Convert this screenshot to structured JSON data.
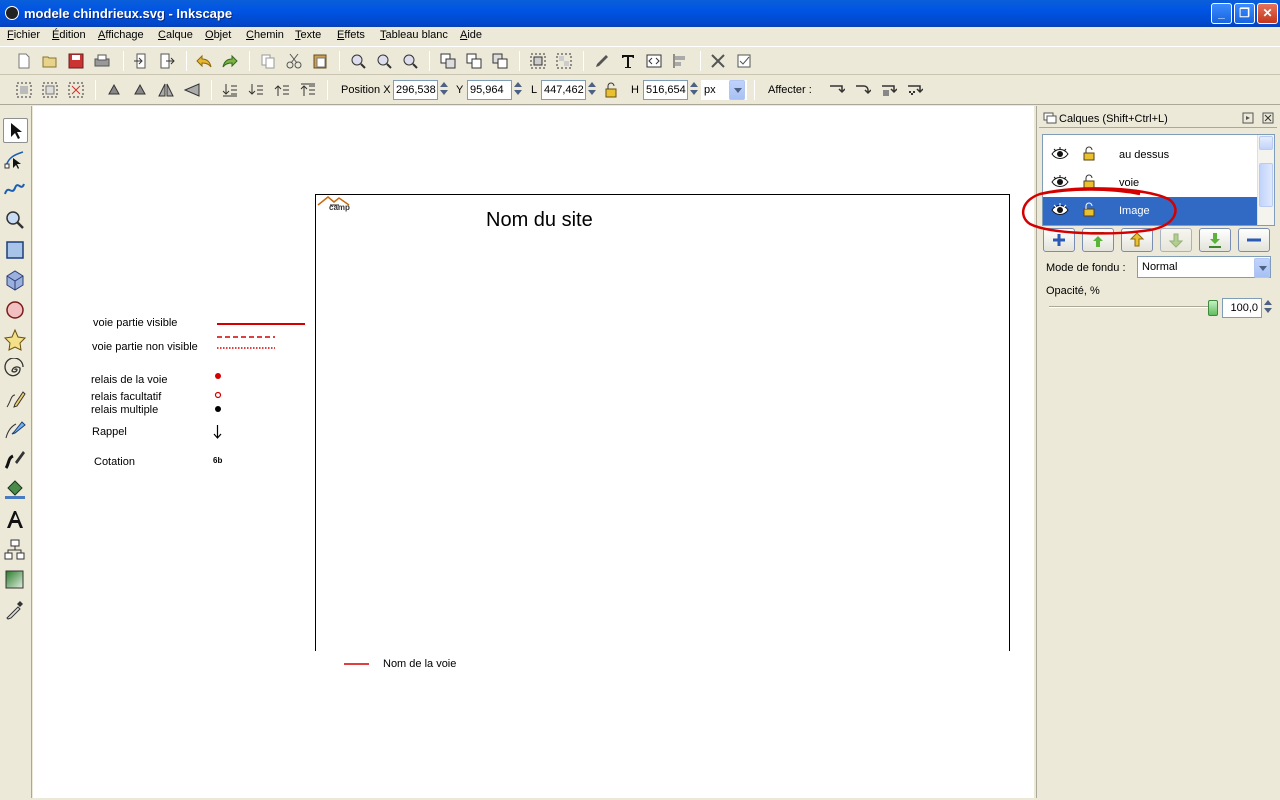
{
  "window": {
    "title": "modele chindrieux.svg - Inkscape",
    "minimize_glyph": "_",
    "maximize_glyph": "❐",
    "close_glyph": "✕"
  },
  "menu": [
    "Fichier",
    "Édition",
    "Affichage",
    "Calque",
    "Objet",
    "Chemin",
    "Texte",
    "Effets",
    "Tableau blanc",
    "Aide"
  ],
  "select_toolbar": {
    "position_x_label": "Position X",
    "x_value": "296,538",
    "y_label": "Y",
    "y_value": "95,964",
    "w_label": "L",
    "w_value": "447,462",
    "h_label": "H",
    "h_value": "516,654",
    "unit": "px",
    "affecter_label": "Affecter :"
  },
  "canvas": {
    "page_title": "Nom du site",
    "logo_text": "camp",
    "legend": {
      "visible": "voie partie visible",
      "non_visible": "voie partie non visible",
      "relais": "relais de la voie",
      "relais_fac": "relais facultatif",
      "relais_mult": "relais multiple",
      "rappel": "Rappel",
      "cotation": "Cotation",
      "cotation_sample": "6b"
    },
    "bottom_legend": "Nom de la voie",
    "accent": "#d40000"
  },
  "layers_panel": {
    "title": "Calques (Shift+Ctrl+L)",
    "layers": [
      {
        "name": "au dessus",
        "selected": false
      },
      {
        "name": "voie",
        "selected": false
      },
      {
        "name": "Image",
        "selected": true
      }
    ],
    "blend_label": "Mode de fondu :",
    "blend_value": "Normal",
    "opacity_label": "Opacité, %",
    "opacity_value": "100,0",
    "opacity_fraction": 1.0
  }
}
